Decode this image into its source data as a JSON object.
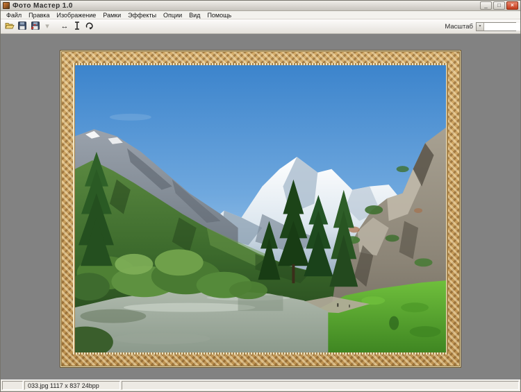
{
  "window": {
    "title": "Фото Мастер 1.0",
    "minimize_glyph": "_",
    "maximize_glyph": "□",
    "close_glyph": "×"
  },
  "menu": {
    "items": [
      "Файл",
      "Правка",
      "Изображение",
      "Рамки",
      "Эффекты",
      "Опции",
      "Вид",
      "Помощь"
    ]
  },
  "toolbar": {
    "icon_names": [
      "open-folder-icon",
      "save-icon",
      "save-as-icon",
      "disabled-tool-icon",
      "flip-horizontal-icon",
      "flip-vertical-icon",
      "rotate-icon"
    ],
    "flip_horizontal_glyph": "↔",
    "disabled_glyph": "▾",
    "zoom_label": "Масштаб",
    "zoom_value": ""
  },
  "statusbar": {
    "panel1": "",
    "file_info": "033.jpg 1117 x 837 24bpp",
    "panel3": ""
  },
  "photo": {
    "description": "Mountain river landscape: snow-capped peaks, forested slope, rocky cliff and green banks inside an ornate carved gold frame",
    "palette": {
      "sky_top": "#3C84CC",
      "sky_horizon": "#CFE3F4",
      "snow": "#FFFFFF",
      "mountain_shadow": "#93A9BE",
      "forest_green": "#2F5526",
      "rock_gray": "#8C94A0",
      "cliff_tan": "#968F80",
      "water_gray_green": "#9AA89A",
      "grass_bright": "#55A42C",
      "frame_gold": "#C9A35E"
    }
  }
}
